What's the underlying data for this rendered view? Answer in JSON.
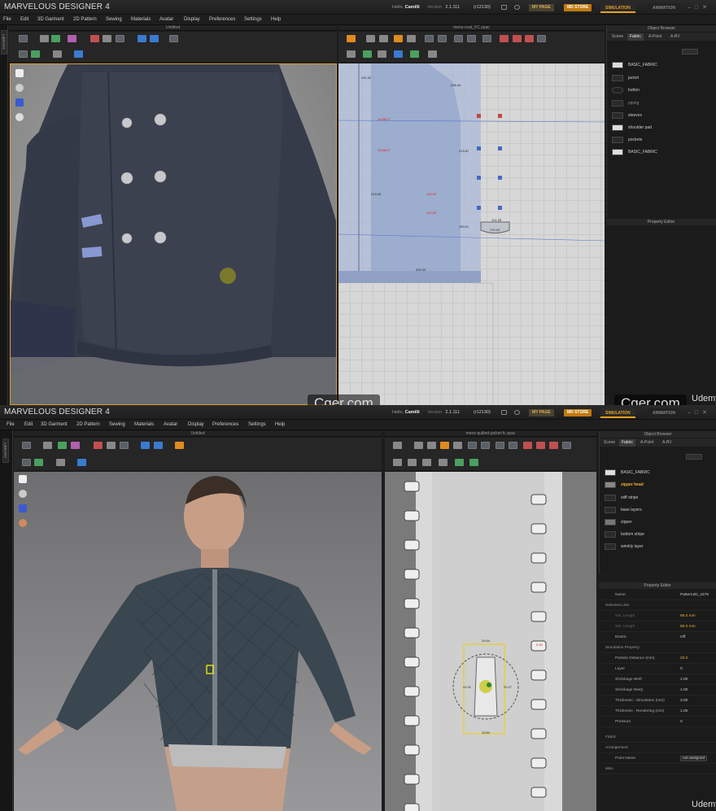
{
  "app_title": "MARVELOUS DESIGNER 4",
  "greeting": "Hello,",
  "user_name": "Camilli",
  "version_label": "Version",
  "version_number": "2.1.111",
  "build": "(r12130)",
  "my_page": "MY PAGE",
  "md_store": "MD STORE",
  "simulation": "SIMULATION",
  "animation": "ANIMATION",
  "menu": [
    "File",
    "Edit",
    "3D Garment",
    "2D Pattern",
    "Sewing",
    "Materials",
    "Avatar",
    "Display",
    "Preferences",
    "Settings",
    "Help"
  ],
  "library_label": "LIBRARY",
  "viewport_title": "Untitled",
  "top": {
    "pattern_file": "mens-coat_FC.zpac",
    "object_browser": "Object Browser",
    "tabs": [
      "Scene",
      "Fabric",
      "A-Point",
      "A-BV"
    ],
    "fabrics": [
      {
        "name": "BASIC_FABRIC",
        "swatch": "light"
      },
      {
        "name": "jacket",
        "swatch": "dark"
      },
      {
        "name": "button",
        "swatch": "button"
      },
      {
        "name": "piping",
        "swatch": "dark"
      },
      {
        "name": "sleeves",
        "swatch": "dark"
      },
      {
        "name": "shoulder pad",
        "swatch": "light"
      },
      {
        "name": "pockets",
        "swatch": "dark"
      },
      {
        "name": "BASIC_FABRIC",
        "swatch": "light"
      }
    ],
    "property_editor": "Property Editor",
    "measurements": [
      "240.32",
      "236.44",
      "213.87",
      "210.00",
      "200.00",
      "190.01",
      "121.33",
      "170.03",
      "115.00",
      "112.00",
      "18.88.07",
      "16.88.07"
    ]
  },
  "bottom": {
    "pattern_file": "mens-quilted-jacket-fc.zpac",
    "object_browser": "Object Browser",
    "tabs": [
      "Scene",
      "Fabric",
      "A-Point",
      "A-BV"
    ],
    "fabrics": [
      {
        "name": "BASIC_FABRIC",
        "swatch": "light",
        "selected": false
      },
      {
        "name": "zipper head",
        "swatch": "zipper",
        "selected": true
      },
      {
        "name": "stiff stripe",
        "swatch": "dark",
        "selected": false
      },
      {
        "name": "base layers",
        "swatch": "dark",
        "selected": false
      },
      {
        "name": "zipper",
        "swatch": "zipper",
        "selected": false
      },
      {
        "name": "bottom stripe",
        "swatch": "dark",
        "selected": false
      },
      {
        "name": "wrinkly layer",
        "swatch": "dark",
        "selected": false
      }
    ],
    "property_editor": "Property Editor",
    "properties": [
      {
        "label": "Name",
        "value": "Pattern2D_4379",
        "kind": "row"
      },
      {
        "label": "Selected Line",
        "value": "",
        "kind": "section"
      },
      {
        "label": "Sel. Length",
        "value": "68.0 mm",
        "kind": "sub",
        "highlight": true
      },
      {
        "label": "Sel. Length",
        "value": "68.0 mm",
        "kind": "sub",
        "highlight": true
      },
      {
        "label": "Elastic",
        "value": "Off",
        "kind": "row"
      },
      {
        "label": "Simulation Property",
        "value": "",
        "kind": "section"
      },
      {
        "label": "Particle Distance (mm)",
        "value": "20.0",
        "kind": "row",
        "highlight": true
      },
      {
        "label": "Layer",
        "value": "0",
        "kind": "row"
      },
      {
        "label": "Shrinkage Weft",
        "value": "1.00",
        "kind": "row"
      },
      {
        "label": "Shrinkage Warp",
        "value": "1.00",
        "kind": "row"
      },
      {
        "label": "Thickness - Simulation (mm)",
        "value": "3.00",
        "kind": "row"
      },
      {
        "label": "Thickness - Rendering (mm)",
        "value": "1.00",
        "kind": "row"
      },
      {
        "label": "Pressure",
        "value": "0",
        "kind": "row"
      },
      {
        "label": "Fabric",
        "value": "",
        "kind": "section"
      },
      {
        "label": "Arrangement",
        "value": "",
        "kind": "section"
      },
      {
        "label": "Point Name",
        "value": "not assigned",
        "kind": "row"
      },
      {
        "label": "Misc.",
        "value": "",
        "kind": "section"
      }
    ],
    "zip_measurements": [
      "10.64",
      "24.31",
      "23.27",
      "10.64",
      "5.50"
    ]
  },
  "watermark": "Cger.com",
  "udemy": "Udemy",
  "colors": {
    "accent": "#e8a020",
    "select": "#f0b030",
    "coat": "#3c4150",
    "jacket": "#3a4650"
  }
}
